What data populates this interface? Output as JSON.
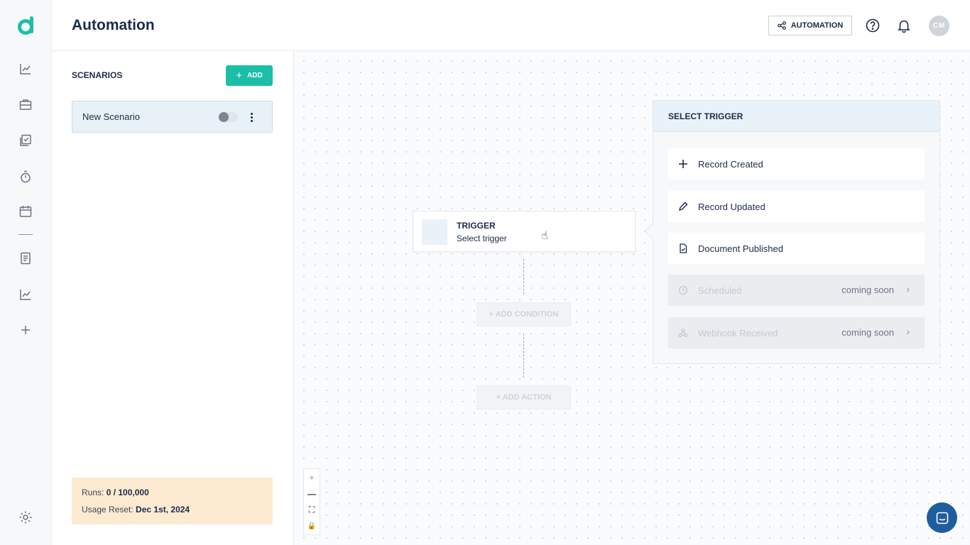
{
  "header": {
    "title": "Automation",
    "automation_button": "AUTOMATION",
    "avatar_initials": "CM"
  },
  "rail": {
    "icons": [
      "logo-icon",
      "chart-line-icon",
      "briefcase-icon",
      "checklist-icon",
      "timer-icon",
      "calendar-icon",
      "document-icon",
      "chart-line-icon",
      "plus-icon",
      "settings-icon"
    ]
  },
  "scenarios": {
    "title": "SCENARIOS",
    "add_label": "ADD",
    "items": [
      {
        "name": "New Scenario",
        "enabled": false
      }
    ]
  },
  "usage": {
    "runs_label": "Runs:",
    "runs_value": "0 / 100,000",
    "reset_label": "Usage Reset:",
    "reset_value": "Dec 1st, 2024"
  },
  "canvas": {
    "trigger_title": "TRIGGER",
    "trigger_sub": "Select trigger",
    "add_condition": "+ ADD CONDITION",
    "add_action": "+ ADD ACTION",
    "zoom_controls": [
      "+",
      "—",
      "⛶",
      "🔒"
    ]
  },
  "select_trigger": {
    "title": "SELECT TRIGGER",
    "options": [
      {
        "label": "Record Created",
        "icon": "plus-icon",
        "disabled": false,
        "note": ""
      },
      {
        "label": "Record Updated",
        "icon": "pencil-icon",
        "disabled": false,
        "note": ""
      },
      {
        "label": "Document Published",
        "icon": "document-check-icon",
        "disabled": false,
        "note": ""
      },
      {
        "label": "Scheduled",
        "icon": "clock-icon",
        "disabled": true,
        "note": "coming soon"
      },
      {
        "label": "Webhook Received",
        "icon": "webhook-icon",
        "disabled": true,
        "note": "coming soon"
      }
    ]
  },
  "colors": {
    "accent": "#1bbfa8",
    "dark": "#1d2b4a",
    "chat": "#1f5e9e",
    "usage_bg": "#fcebd0"
  }
}
